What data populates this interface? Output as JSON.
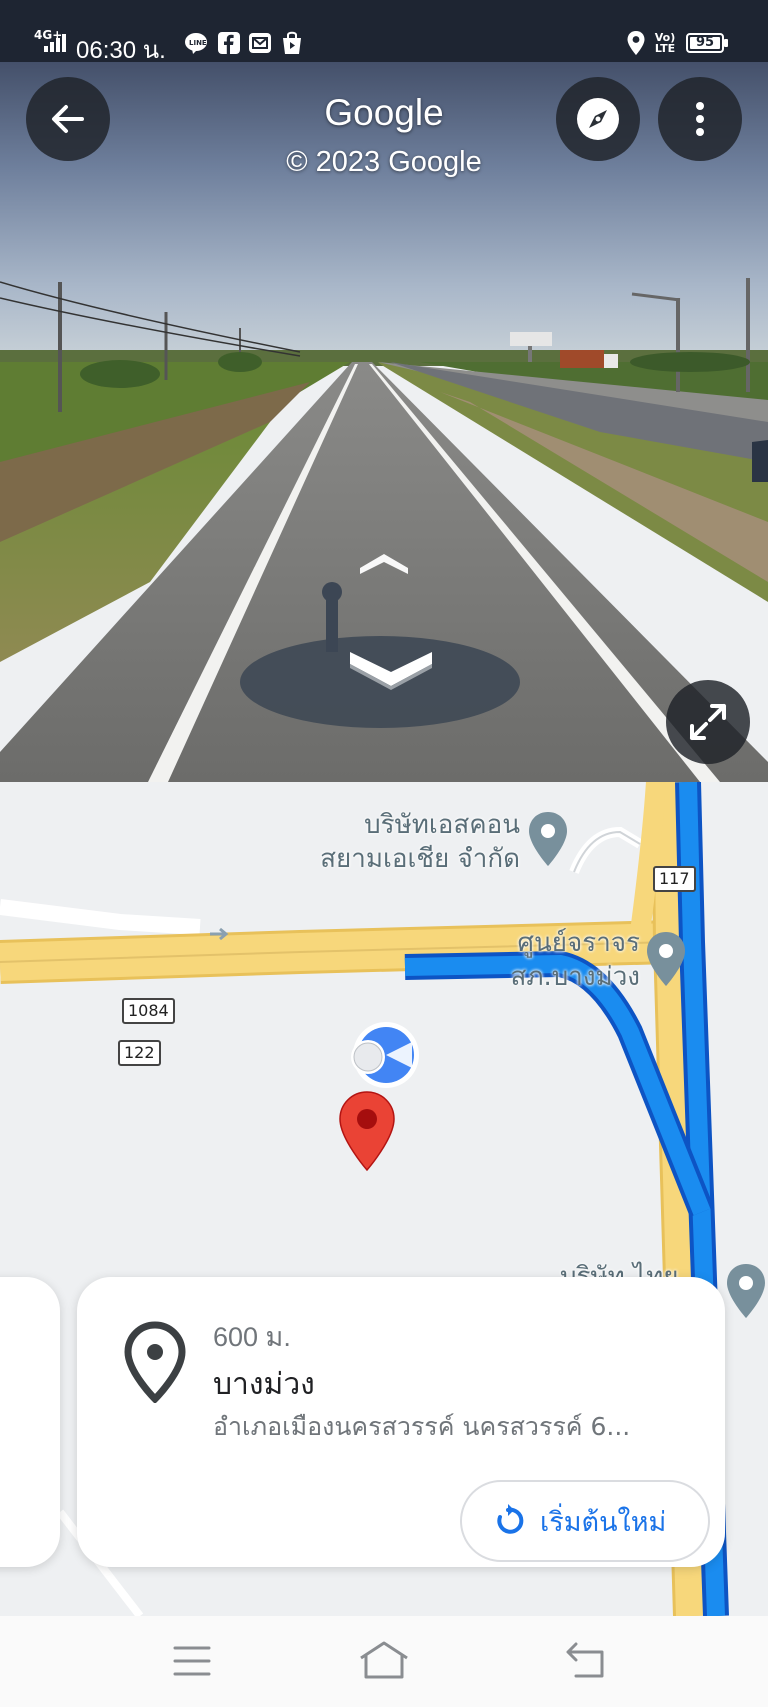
{
  "status_bar": {
    "network": "4G+",
    "time": "06:30 น.",
    "volte": "Vo) LTE",
    "battery": "95"
  },
  "street_view": {
    "title": "Google",
    "copyright": "© 2023 Google"
  },
  "map": {
    "poi_1": [
      "บริษัทเอสคอน",
      "สยามเอเชีย จำกัด"
    ],
    "poi_2": [
      "ศูนย์จราจร",
      "สภ.บางม่วง"
    ],
    "poi_3": "บริษัท ไทย",
    "shields": [
      "117",
      "1084",
      "122"
    ]
  },
  "place_card": {
    "distance": "600 ม.",
    "name": "บางม่วง",
    "address": "อำเภอเมืองนครสวรรค์ นครสวรรค์ 6...",
    "restart_label": "เริ่มต้นใหม่"
  },
  "colors": {
    "route": "#1a73e8",
    "road": "#f7d77b",
    "pin": "#ea4335",
    "accent": "#1a73e8"
  }
}
